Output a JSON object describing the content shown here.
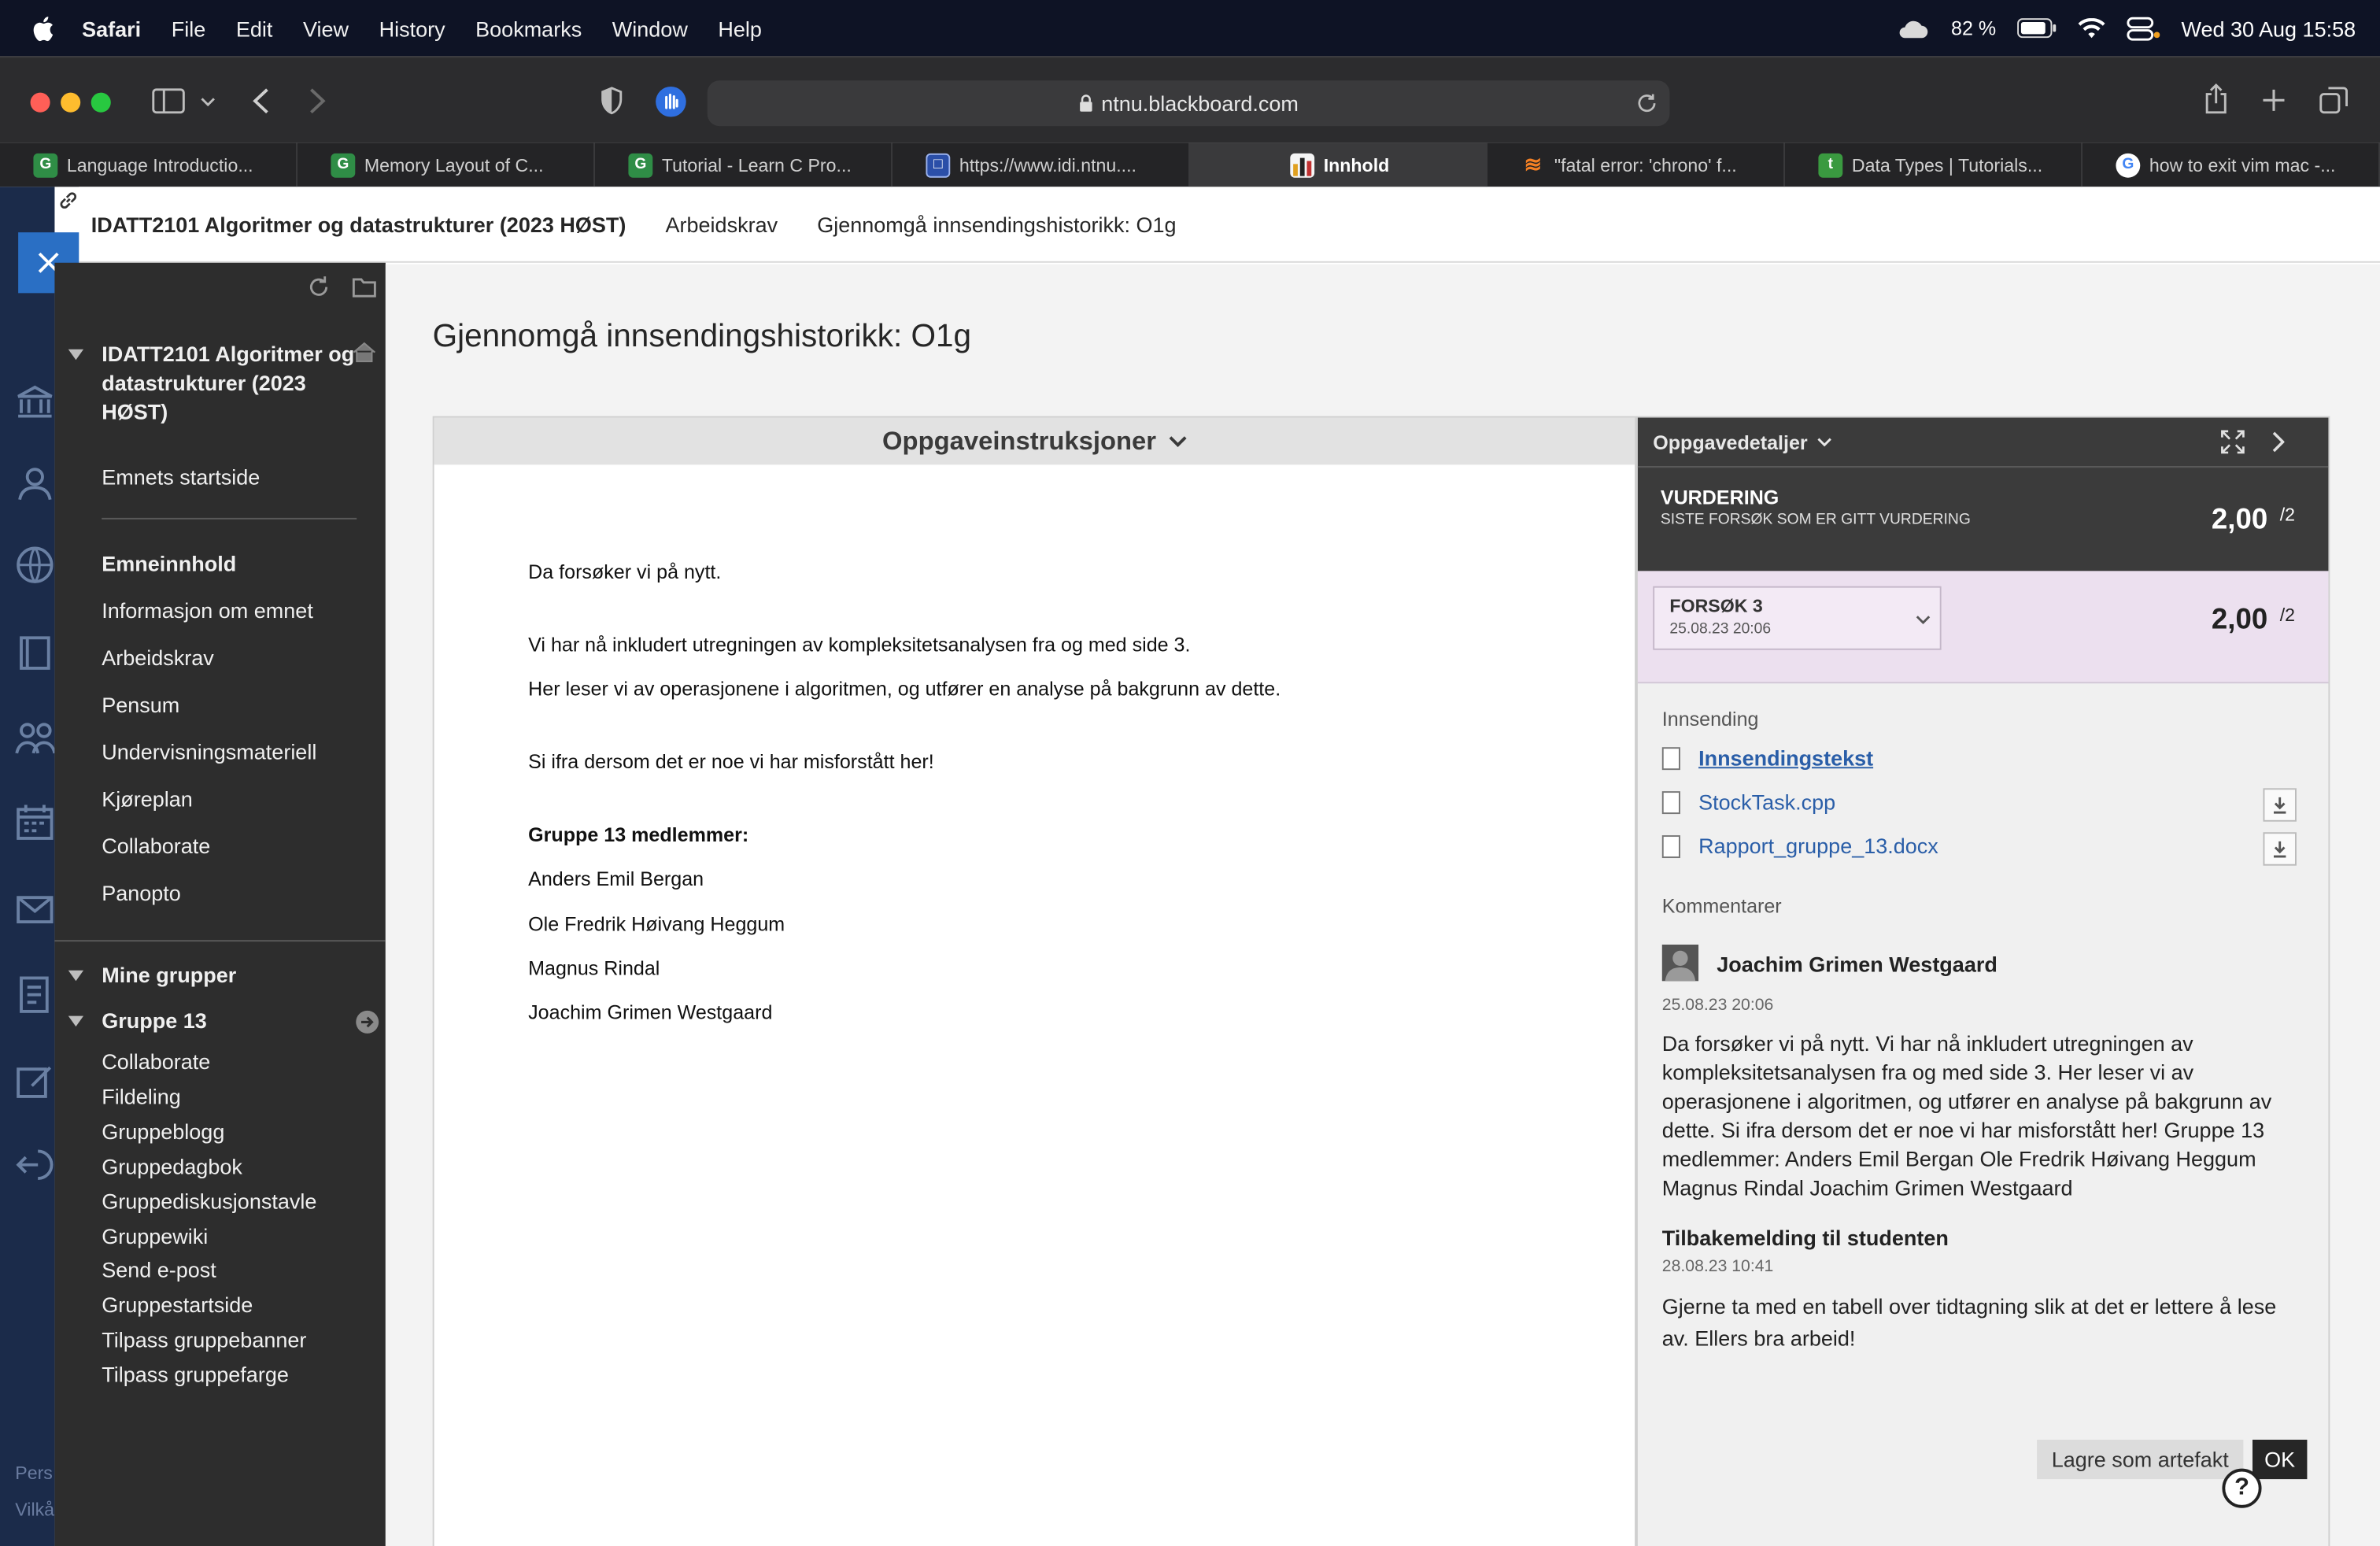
{
  "menubar": {
    "app": "Safari",
    "items": [
      "File",
      "Edit",
      "View",
      "History",
      "Bookmarks",
      "Window",
      "Help"
    ],
    "battery": "82 %",
    "datetime": "Wed 30 Aug  15:58"
  },
  "toolbar": {
    "url": "ntnu.blackboard.com"
  },
  "tabs": [
    "Language Introductio...",
    "Memory Layout of C...",
    "Tutorial - Learn C Pro...",
    "https://www.idi.ntnu....",
    "Innhold",
    "\"fatal error: 'chrono' f...",
    "Data Types | Tutorials...",
    "how to exit vim mac -..."
  ],
  "header": {
    "course": "IDATT2101 Algoritmer og datastrukturer (2023 HØST)",
    "crumb1": "Arbeidskrav",
    "crumb2": "Gjennomgå innsendingshistorikk: O1g"
  },
  "sidebar": {
    "course_title_1": "IDATT2101 Algoritmer og",
    "course_title_2": "datastrukturer (2023",
    "course_title_3": "HØST)",
    "items": [
      "Emnets startside",
      "Emneinnhold",
      "Informasjon om emnet",
      "Arbeidskrav",
      "Pensum",
      "Undervisningsmateriell",
      "Kjøreplan",
      "Collaborate",
      "Panopto"
    ],
    "my_groups": "Mine grupper",
    "group": "Gruppe 13",
    "group_items": [
      "Collaborate",
      "Fildeling",
      "Gruppeblogg",
      "Gruppedagbok",
      "Gruppediskusjonstavle",
      "Gruppewiki",
      "Send e-post",
      "Gruppestartside",
      "Tilpass gruppebanner",
      "Tilpass gruppefarge"
    ],
    "footer_1": "Pers",
    "footer_2": "Vilkå"
  },
  "main": {
    "title": "Gjennomgå innsendingshistorikk: O1g",
    "instructions_header": "Oppgaveinstruksjoner",
    "instructions": [
      "Da forsøker vi på nytt.",
      "Vi har nå inkludert utregningen av kompleksitetsanalysen fra og med side 3.",
      "Her leser vi av operasjonene i algoritmen, og utfører en analyse på bakgrunn av dette.",
      "Si ifra dersom det er noe vi har misforstått her!",
      "Gruppe 13 medlemmer:",
      "Anders Emil Bergan",
      "Ole Fredrik Høivang Heggum",
      "Magnus Rindal",
      "Joachim Grimen Westgaard"
    ]
  },
  "details": {
    "header": "Oppgavedetaljer",
    "grade_label": "VURDERING",
    "grade_sub": "SISTE FORSØK SOM ER GITT VURDERING",
    "grade_value": "2,00",
    "grade_max": "/2",
    "attempt_label": "FORSØK 3",
    "attempt_date": "25.08.23 20:06",
    "attempt_value": "2,00",
    "attempt_max": "/2",
    "submission_label": "Innsending",
    "files": [
      "Innsendingstekst",
      "StockTask.cpp",
      "Rapport_gruppe_13.docx"
    ],
    "comments_label": "Kommentarer",
    "commenter": "Joachim Grimen Westgaard",
    "comment_date": "25.08.23 20:06",
    "comment_text": "Da forsøker vi på nytt.  Vi har nå inkludert utregningen av kompleksitetsanalysen fra og med side 3. Her leser vi av operasjonene i algoritmen, og utfører en analyse på bakgrunn av dette. Si ifra dersom det er noe vi har misforstått her! Gruppe 13 medlemmer: Anders Emil Bergan Ole Fredrik Høivang Heggum Magnus Rindal Joachim Grimen Westgaard",
    "feedback_label": "Tilbakemelding til studenten",
    "feedback_date": "28.08.23 10:41",
    "feedback_text": "Gjerne ta med en tabell over tidtagning slik at det er lettere å lese av. Ellers bra arbeid!",
    "save_button": "Lagre som artefakt",
    "ok_button": "OK",
    "help_glyph": "?"
  },
  "colors": {
    "accent": "#2a6fc4",
    "attempt_bg": "#ece0ef",
    "sidebar_bg": "#2d2d2d",
    "nav_bg": "#1b2b4a"
  }
}
